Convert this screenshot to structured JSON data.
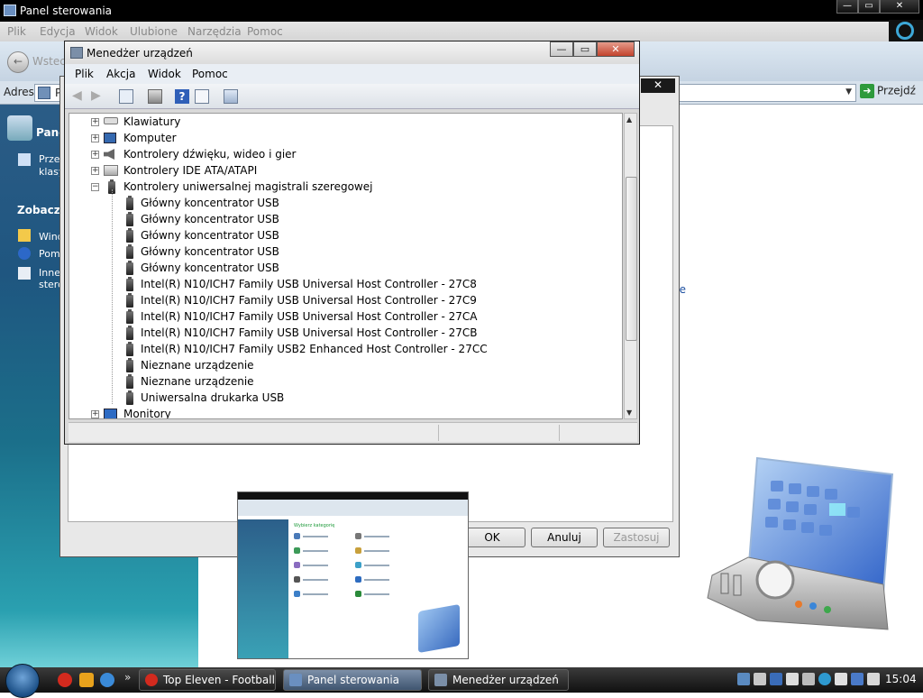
{
  "control_panel": {
    "title": "Panel sterowania",
    "menu": [
      "Plik",
      "Edycja",
      "Widok",
      "Ulubione",
      "Narzędzia",
      "Pomoc"
    ],
    "back_label": "Wstecz",
    "address_label": "Adres",
    "address_value": "P",
    "go_label": "Przejdź",
    "sidebar": {
      "header": "Panel",
      "switch_classic": [
        "Przeł",
        "klasy"
      ],
      "see_also": "Zobacz te",
      "links": [
        "Wind",
        "Pom",
        "Inne",
        "stero"
      ]
    },
    "partial_text": "ne"
  },
  "properties_dialog": {
    "close_label": "✕",
    "ok_label": "OK",
    "cancel_label": "Anuluj",
    "apply_label": "Zastosuj"
  },
  "device_manager": {
    "title": "Menedżer urządzeń",
    "menu": [
      "Plik",
      "Akcja",
      "Widok",
      "Pomoc"
    ],
    "tree": [
      {
        "label": "Klawiatury",
        "level": 0,
        "expander": "+",
        "icon": "keyboard-icon"
      },
      {
        "label": "Komputer",
        "level": 0,
        "expander": "+",
        "icon": "computer-icon"
      },
      {
        "label": "Kontrolery dźwięku, wideo i gier",
        "level": 0,
        "expander": "+",
        "icon": "speaker-icon"
      },
      {
        "label": "Kontrolery IDE ATA/ATAPI",
        "level": 0,
        "expander": "+",
        "icon": "drive-icon"
      },
      {
        "label": "Kontrolery uniwersalnej magistrali szeregowej",
        "level": 0,
        "expander": "−",
        "icon": "usb-icon"
      },
      {
        "label": "Główny koncentrator USB",
        "level": 1,
        "icon": "usb-icon"
      },
      {
        "label": "Główny koncentrator USB",
        "level": 1,
        "icon": "usb-icon"
      },
      {
        "label": "Główny koncentrator USB",
        "level": 1,
        "icon": "usb-icon"
      },
      {
        "label": "Główny koncentrator USB",
        "level": 1,
        "icon": "usb-icon"
      },
      {
        "label": "Główny koncentrator USB",
        "level": 1,
        "icon": "usb-icon"
      },
      {
        "label": "Intel(R) N10/ICH7 Family USB Universal Host Controller - 27C8",
        "level": 1,
        "icon": "usb-icon"
      },
      {
        "label": "Intel(R) N10/ICH7 Family USB Universal Host Controller - 27C9",
        "level": 1,
        "icon": "usb-icon"
      },
      {
        "label": "Intel(R) N10/ICH7 Family USB Universal Host Controller - 27CA",
        "level": 1,
        "icon": "usb-icon"
      },
      {
        "label": "Intel(R) N10/ICH7 Family USB Universal Host Controller - 27CB",
        "level": 1,
        "icon": "usb-icon"
      },
      {
        "label": "Intel(R) N10/ICH7 Family USB2 Enhanced Host Controller - 27CC",
        "level": 1,
        "icon": "usb-icon"
      },
      {
        "label": "Nieznane urządzenie",
        "level": 1,
        "icon": "usb-icon"
      },
      {
        "label": "Nieznane urządzenie",
        "level": 1,
        "icon": "usb-icon"
      },
      {
        "label": "Uniwersalna drukarka USB",
        "level": 1,
        "icon": "usb-icon"
      },
      {
        "label": "Monitory",
        "level": 0,
        "expander": "+",
        "icon": "monitor-icon"
      }
    ]
  },
  "thumbnail": {
    "category_heading": "Wybierz kategorię"
  },
  "taskbar": {
    "tasks": [
      {
        "label": "Top Eleven - Football...",
        "icon": "opera-icon",
        "active": false
      },
      {
        "label": "Panel sterowania",
        "icon": "control-panel-icon",
        "active": true
      },
      {
        "label": "Menedżer urządzeń",
        "icon": "device-manager-icon",
        "active": false
      }
    ],
    "clock": "15:04"
  },
  "colors": {
    "accent": "#1e50a0",
    "sidebar_top": "#2b5c86",
    "sidebar_bottom": "#6fd0d8"
  }
}
